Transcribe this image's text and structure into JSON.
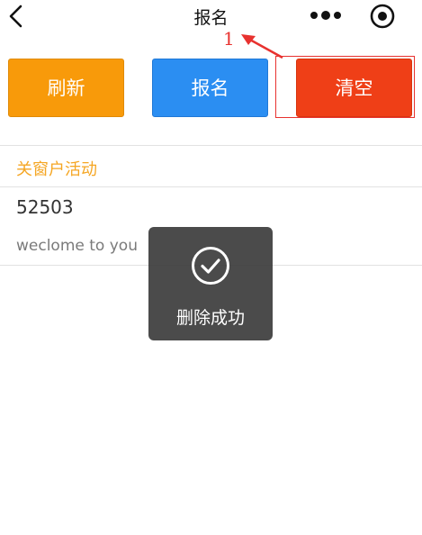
{
  "navbar": {
    "title": "报名",
    "back_icon": "chevron-left-icon",
    "more_icon": "more-dots-icon",
    "close_icon": "target-close-icon"
  },
  "annotation": {
    "number": "1",
    "color": "#e8322f"
  },
  "actions": {
    "refresh_label": "刷新",
    "signup_label": "报名",
    "clear_label": "清空",
    "colors": {
      "refresh": "#f89a0a",
      "signup": "#2b8ef2",
      "clear": "#ef3f17"
    }
  },
  "list": {
    "section_title": "关窗户活动",
    "item_number": "52503",
    "item_desc": "weclome to you"
  },
  "toast": {
    "icon": "check-circle-icon",
    "text": "删除成功"
  }
}
